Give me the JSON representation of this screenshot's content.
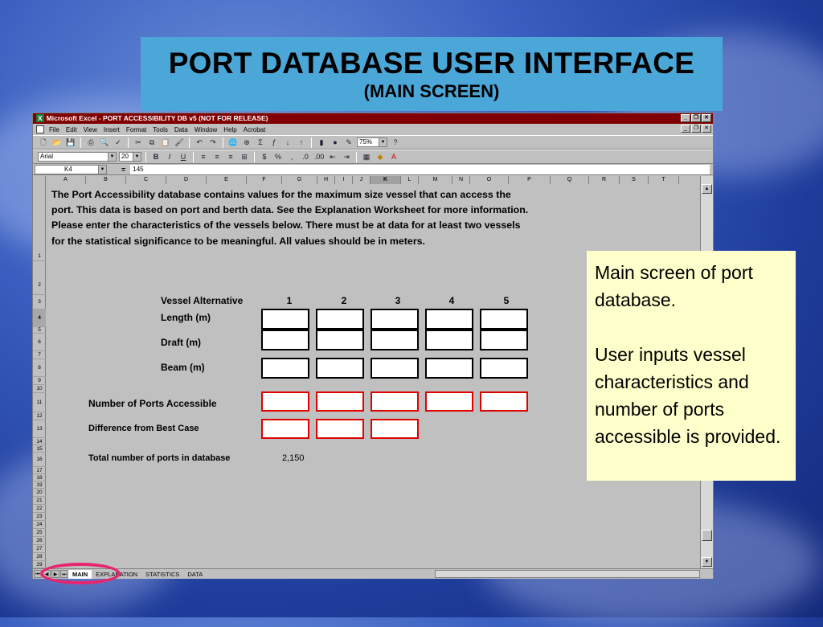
{
  "slide": {
    "title": "PORT DATABASE USER INTERFACE",
    "subtitle": "(MAIN SCREEN)",
    "note": {
      "line1": "Main screen of port database.",
      "line2": "User inputs vessel characteristics and number of ports accessible is provided."
    }
  },
  "excel": {
    "window_title": "Microsoft Excel - PORT ACCESSIBILITY DB v5 (NOT FOR RELEASE)",
    "menu": [
      "File",
      "Edit",
      "View",
      "Insert",
      "Format",
      "Tools",
      "Data",
      "Window",
      "Help",
      "Acrobat"
    ],
    "zoom": "75%",
    "font": "Arial",
    "font_size": "20",
    "name_box": "K4",
    "formula_value": "145",
    "columns": [
      "A",
      "B",
      "C",
      "D",
      "E",
      "F",
      "G",
      "H",
      "I",
      "J",
      "K",
      "L",
      "M",
      "N",
      "O",
      "P",
      "Q",
      "R",
      "S",
      "T"
    ],
    "selected_column": "K",
    "rows": [
      "1",
      "2",
      "3",
      "4",
      "5",
      "6",
      "7",
      "8",
      "9",
      "10",
      "11",
      "12",
      "13",
      "14",
      "15",
      "16",
      "17",
      "18",
      "19",
      "20",
      "21",
      "22",
      "23",
      "24",
      "25",
      "26",
      "27",
      "28",
      "29",
      "30"
    ],
    "intro_text": "The Port Accessibility database contains values for the maximum size vessel that can access the port. This data is based on port and berth data.  See the Explanation Worksheet for more information.  Please enter the characteristics of the vessels below.  There must be at data for at least two vessels for the statistical significance to be meaningful.  All values should be in meters.",
    "labels": {
      "vessel_alt": "Vessel Alternative",
      "length": "Length (m)",
      "draft": "Draft (m)",
      "beam": "Beam (m)",
      "ports_accessible": "Number of Ports Accessible",
      "diff_best": "Difference from Best Case",
      "total_ports": "Total number of ports in database"
    },
    "alternatives": [
      "1",
      "2",
      "3",
      "4",
      "5"
    ],
    "total_ports_value": "2,150",
    "tabs": [
      "MAIN",
      "EXPLANATION",
      "STATISTICS",
      "DATA"
    ],
    "active_tab": "MAIN"
  }
}
